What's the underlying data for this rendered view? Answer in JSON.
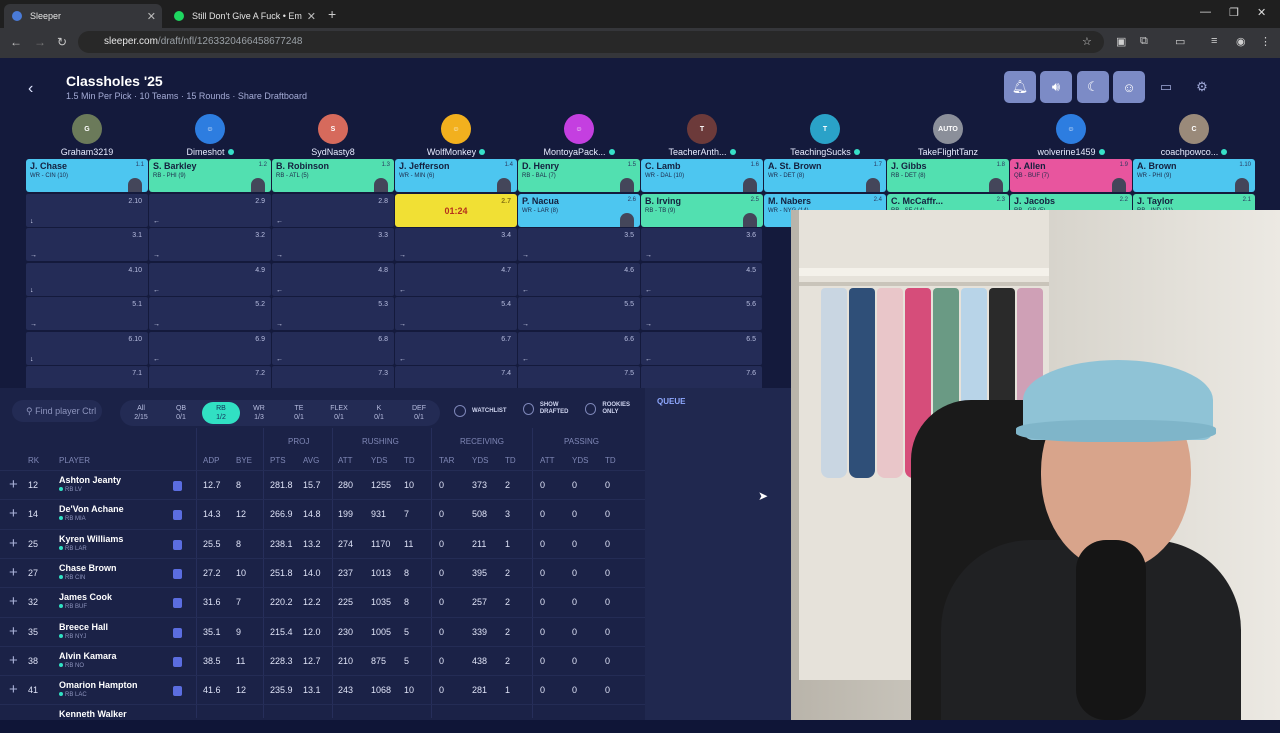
{
  "browser": {
    "tabs": [
      {
        "title": "Sleeper",
        "color": "#4a7bd8"
      },
      {
        "title": "Still Don't Give A Fuck • Em",
        "color": "#1ed760"
      }
    ],
    "url_host": "sleeper.com",
    "url_path": "/draft/nfl/1263320466458677248"
  },
  "draft": {
    "title": "Classholes '25",
    "subtitle": "1.5 Min Per Pick · 10 Teams · 15 Rounds · Share Draftboard",
    "icons": [
      "bell-icon",
      "speaker-icon",
      "moon-icon",
      "smiley-icon",
      "monitor-icon",
      "settings-icon"
    ]
  },
  "teams": [
    {
      "name": "Graham3219",
      "online": false,
      "avatar": "G",
      "avcolor": "#6b7a5a"
    },
    {
      "name": "Dimeshot",
      "online": true,
      "avatar": "☺",
      "avcolor": "#2d7de0"
    },
    {
      "name": "SydNasty8",
      "online": false,
      "avatar": "S",
      "avcolor": "#d66a5c"
    },
    {
      "name": "WolfMonkey",
      "online": true,
      "avatar": "☺",
      "avcolor": "#f2b01e"
    },
    {
      "name": "MontoyaPack...",
      "online": true,
      "avatar": "☺",
      "avcolor": "#c43fe0"
    },
    {
      "name": "TeacherAnth...",
      "online": true,
      "avatar": "T",
      "avcolor": "#6c3a3a"
    },
    {
      "name": "TeachingSucks",
      "online": true,
      "avatar": "T",
      "avcolor": "#2aa2c8"
    },
    {
      "name": "TakeFlightTanz",
      "online": false,
      "avatar": "AUTO",
      "avcolor": "#8b8f9a"
    },
    {
      "name": "wolverine1459",
      "online": true,
      "avatar": "☺",
      "avcolor": "#2d7de0"
    },
    {
      "name": "coachpowco...",
      "online": true,
      "avatar": "C",
      "avcolor": "#9a8a7a"
    }
  ],
  "round1": [
    {
      "name": "J. Chase",
      "pos": "WR - CIN (10)",
      "no": "1.1",
      "type": "wr"
    },
    {
      "name": "S. Barkley",
      "pos": "RB - PHI (9)",
      "no": "1.2",
      "type": "rb"
    },
    {
      "name": "B. Robinson",
      "pos": "RB - ATL (5)",
      "no": "1.3",
      "type": "rb"
    },
    {
      "name": "J. Jefferson",
      "pos": "WR - MIN (6)",
      "no": "1.4",
      "type": "wr"
    },
    {
      "name": "D. Henry",
      "pos": "RB - BAL (7)",
      "no": "1.5",
      "type": "rb"
    },
    {
      "name": "C. Lamb",
      "pos": "WR - DAL (10)",
      "no": "1.6",
      "type": "wr"
    },
    {
      "name": "A. St. Brown",
      "pos": "WR - DET (8)",
      "no": "1.7",
      "type": "wr"
    },
    {
      "name": "J. Gibbs",
      "pos": "RB - DET (8)",
      "no": "1.8",
      "type": "rb"
    },
    {
      "name": "J. Allen",
      "pos": "QB - BUF (7)",
      "no": "1.9",
      "type": "qb"
    },
    {
      "name": "A. Brown",
      "pos": "WR - PHI (9)",
      "no": "1.10",
      "type": "wr"
    }
  ],
  "round2": [
    {
      "no": "2.10",
      "arrow": "↓"
    },
    {
      "no": "2.9",
      "arrow": "←"
    },
    {
      "no": "2.8",
      "arrow": "←"
    },
    {
      "timer": "01:24",
      "no": "2.7"
    },
    {
      "name": "P. Nacua",
      "pos": "WR - LAR (8)",
      "no": "2.6",
      "type": "wr"
    },
    {
      "name": "B. Irving",
      "pos": "RB - TB (9)",
      "no": "2.5",
      "type": "rb"
    },
    {
      "name": "M. Nabers",
      "pos": "WR - NYG (14)",
      "no": "2.4",
      "type": "wr"
    },
    {
      "name": "C. McCaffr...",
      "pos": "RB - SF (14)",
      "no": "2.3",
      "type": "rb"
    },
    {
      "name": "J. Jacobs",
      "pos": "RB - GB (5)",
      "no": "2.2",
      "type": "rb"
    },
    {
      "name": "J. Taylor",
      "pos": "RB - IND (11)",
      "no": "2.1",
      "type": "rb"
    }
  ],
  "board_rows": [
    {
      "arrow": "→",
      "nos": [
        "3.1",
        "3.2",
        "3.3",
        "3.4",
        "3.5",
        "3.6"
      ]
    },
    {
      "arrow": "↓",
      "first": "←",
      "nos": [
        "4.10",
        "4.9",
        "4.8",
        "4.7",
        "4.6",
        "4.5"
      ]
    },
    {
      "arrow": "→",
      "nos": [
        "5.1",
        "5.2",
        "5.3",
        "5.4",
        "5.5",
        "5.6"
      ]
    },
    {
      "arrow": "↓",
      "first": "←",
      "nos": [
        "6.10",
        "6.9",
        "6.8",
        "6.7",
        "6.6",
        "6.5"
      ]
    },
    {
      "arrow": "→",
      "nos": [
        "7.1",
        "7.2",
        "7.3",
        "7.4",
        "7.5",
        "7.6"
      ]
    }
  ],
  "filters": {
    "search_placeholder": "Find player Ctrl",
    "positions": [
      {
        "label": "All",
        "count": "2/15"
      },
      {
        "label": "QB",
        "count": "0/1"
      },
      {
        "label": "RB",
        "count": "1/2",
        "active": true
      },
      {
        "label": "WR",
        "count": "1/3"
      },
      {
        "label": "TE",
        "count": "0/1"
      },
      {
        "label": "FLEX",
        "count": "0/1"
      },
      {
        "label": "K",
        "count": "0/1"
      },
      {
        "label": "DEF",
        "count": "0/1"
      }
    ],
    "watchlist": "WATCHLIST",
    "show_drafted": "SHOW DRAFTED",
    "rookies_only": "ROOKIES ONLY"
  },
  "queue": {
    "label": "QUEUE"
  },
  "table": {
    "groups": [
      "PROJ",
      "RUSHING",
      "RECEIVING",
      "PASSING"
    ],
    "headers": [
      "RK",
      "PLAYER",
      "ADP",
      "BYE",
      "PTS",
      "AVG",
      "ATT",
      "YDS",
      "TD",
      "TAR",
      "YDS",
      "TD",
      "ATT",
      "YDS",
      "TD"
    ],
    "rows": [
      {
        "rk": "12",
        "name": "Ashton Jeanty",
        "team": "RB LV",
        "adp": "12.7",
        "bye": "8",
        "pts": "281.8",
        "avg": "15.7",
        "ratt": "280",
        "ryds": "1255",
        "rtd": "10",
        "tar": "0",
        "cyds": "373",
        "ctd": "2",
        "patt": "0",
        "pyds": "0",
        "ptd": "0"
      },
      {
        "rk": "14",
        "name": "De'Von Achane",
        "team": "RB MIA",
        "adp": "14.3",
        "bye": "12",
        "pts": "266.9",
        "avg": "14.8",
        "ratt": "199",
        "ryds": "931",
        "rtd": "7",
        "tar": "0",
        "cyds": "508",
        "ctd": "3",
        "patt": "0",
        "pyds": "0",
        "ptd": "0"
      },
      {
        "rk": "25",
        "name": "Kyren Williams",
        "team": "RB LAR",
        "adp": "25.5",
        "bye": "8",
        "pts": "238.1",
        "avg": "13.2",
        "ratt": "274",
        "ryds": "1170",
        "rtd": "11",
        "tar": "0",
        "cyds": "211",
        "ctd": "1",
        "patt": "0",
        "pyds": "0",
        "ptd": "0"
      },
      {
        "rk": "27",
        "name": "Chase Brown",
        "team": "RB CIN",
        "adp": "27.2",
        "bye": "10",
        "pts": "251.8",
        "avg": "14.0",
        "ratt": "237",
        "ryds": "1013",
        "rtd": "8",
        "tar": "0",
        "cyds": "395",
        "ctd": "2",
        "patt": "0",
        "pyds": "0",
        "ptd": "0"
      },
      {
        "rk": "32",
        "name": "James Cook",
        "team": "RB BUF",
        "adp": "31.6",
        "bye": "7",
        "pts": "220.2",
        "avg": "12.2",
        "ratt": "225",
        "ryds": "1035",
        "rtd": "8",
        "tar": "0",
        "cyds": "257",
        "ctd": "2",
        "patt": "0",
        "pyds": "0",
        "ptd": "0"
      },
      {
        "rk": "35",
        "name": "Breece Hall",
        "team": "RB NYJ",
        "adp": "35.1",
        "bye": "9",
        "pts": "215.4",
        "avg": "12.0",
        "ratt": "230",
        "ryds": "1005",
        "rtd": "5",
        "tar": "0",
        "cyds": "339",
        "ctd": "2",
        "patt": "0",
        "pyds": "0",
        "ptd": "0"
      },
      {
        "rk": "38",
        "name": "Alvin Kamara",
        "team": "RB NO",
        "adp": "38.5",
        "bye": "11",
        "pts": "228.3",
        "avg": "12.7",
        "ratt": "210",
        "ryds": "875",
        "rtd": "5",
        "tar": "0",
        "cyds": "438",
        "ctd": "2",
        "patt": "0",
        "pyds": "0",
        "ptd": "0"
      },
      {
        "rk": "41",
        "name": "Omarion Hampton",
        "team": "RB LAC",
        "adp": "41.6",
        "bye": "12",
        "pts": "235.9",
        "avg": "13.1",
        "ratt": "243",
        "ryds": "1068",
        "rtd": "10",
        "tar": "0",
        "cyds": "281",
        "ctd": "1",
        "patt": "0",
        "pyds": "0",
        "ptd": "0"
      }
    ],
    "partial_row": "Kenneth Walker"
  }
}
